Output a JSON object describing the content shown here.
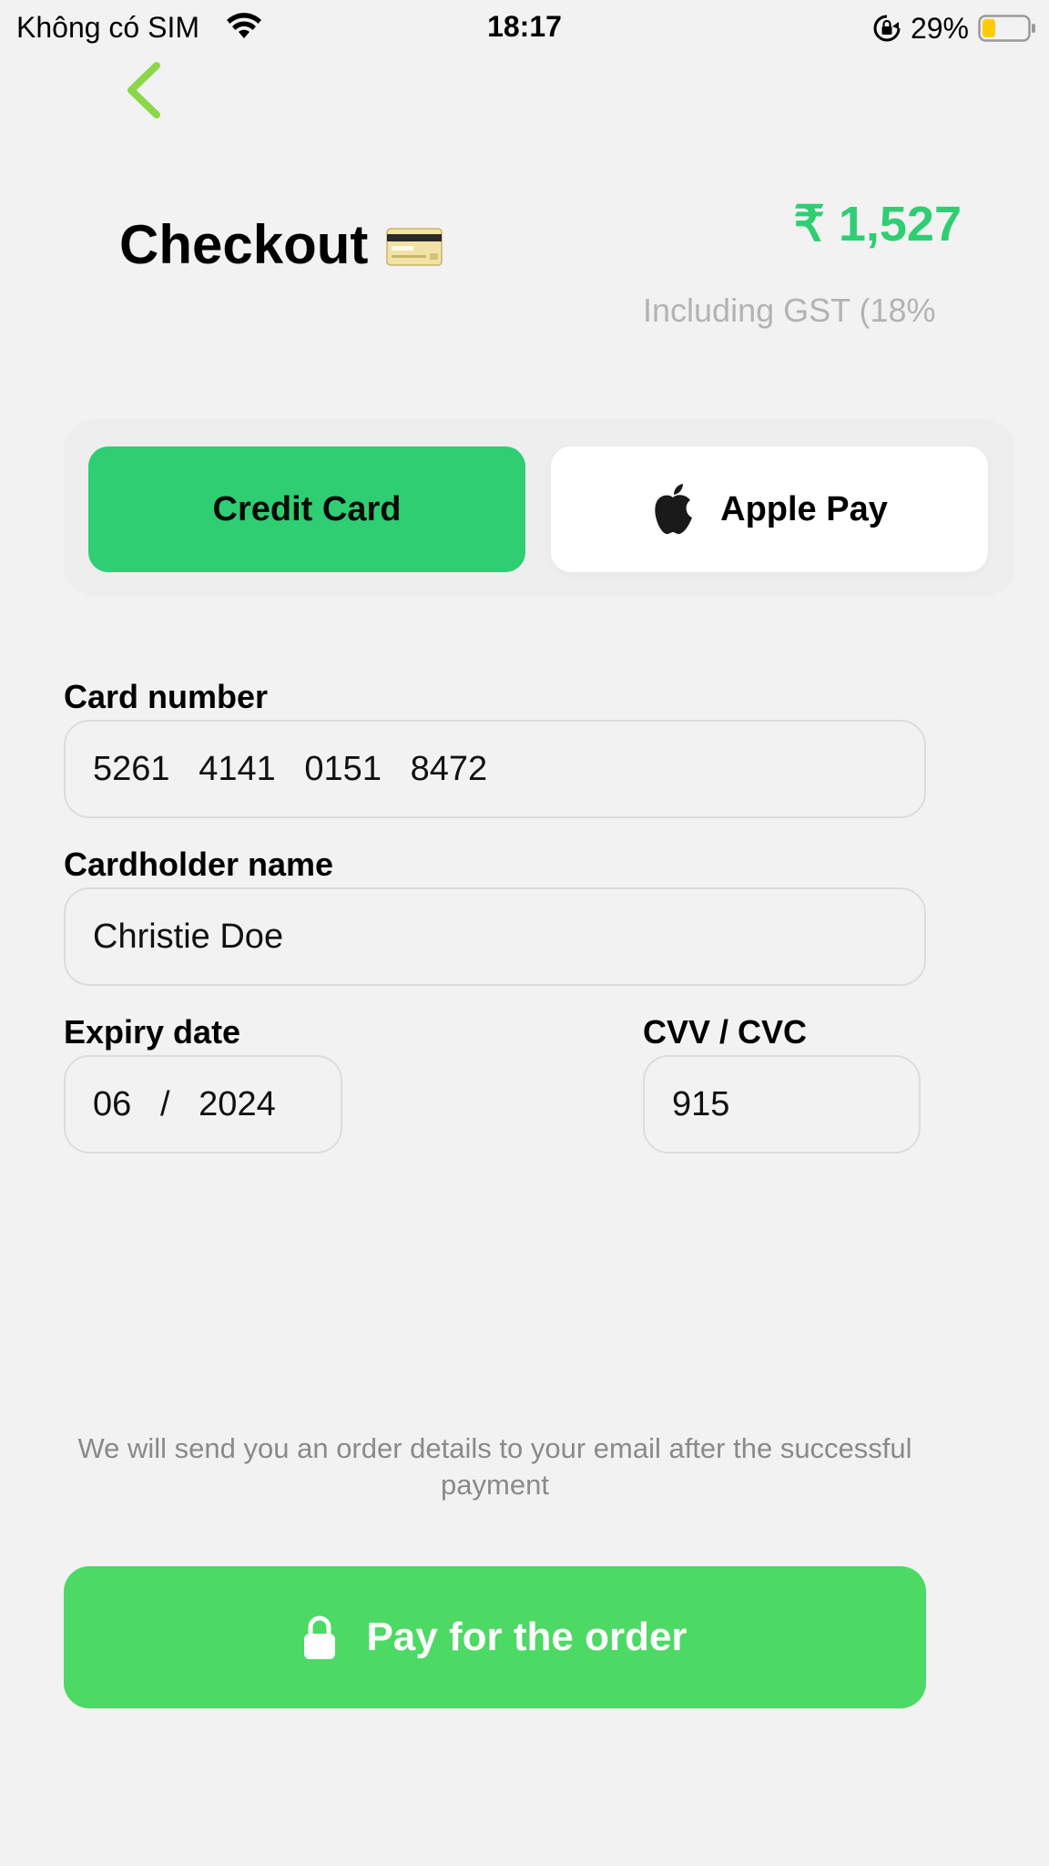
{
  "status_bar": {
    "carrier": "Không có SIM",
    "time": "18:17",
    "battery_percent": "29%",
    "battery_level": 0.29,
    "icons": [
      "wifi-icon",
      "rotation-lock-icon",
      "battery-icon"
    ]
  },
  "header": {
    "back_icon": "chevron-left-icon",
    "title": "Checkout",
    "title_icon": "credit-card-emoji-icon",
    "total": "₹ 1,527",
    "tax_note": "Including GST (18%"
  },
  "payment_methods": [
    {
      "label": "Credit Card",
      "selected": true
    },
    {
      "label": "Apple Pay",
      "icon": "apple-icon",
      "selected": false
    }
  ],
  "form": {
    "card_number": {
      "label": "Card number",
      "value": "5261   4141   0151   8472"
    },
    "cardholder": {
      "label": "Cardholder name",
      "value": "Christie Doe"
    },
    "expiry": {
      "label": "Expiry date",
      "value": "06   /   2024"
    },
    "cvv": {
      "label": "CVV / CVC",
      "value": "915"
    }
  },
  "notice": "We will send you an order details to your email after the successful payment",
  "pay_button": {
    "label": "Pay for the order",
    "icon": "padlock-icon"
  },
  "colors": {
    "accent": "#2fce73",
    "pay_button": "#4cd964",
    "back_chevron": "#8cd64a",
    "background": "#f2f2f2"
  }
}
